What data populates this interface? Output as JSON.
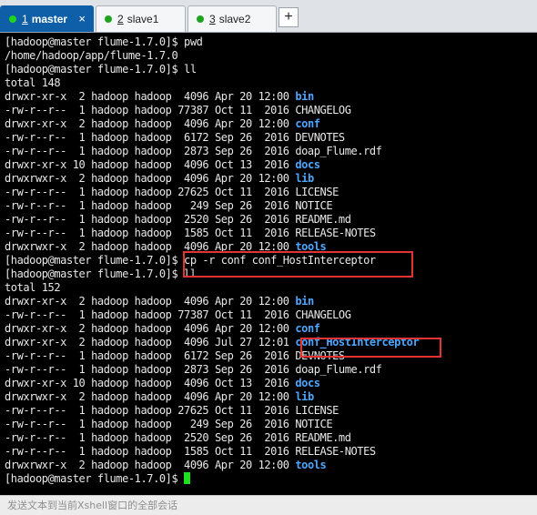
{
  "tabs": [
    {
      "num": "1",
      "label": "master",
      "dot_color": "#1fd41f",
      "active": true
    },
    {
      "num": "2",
      "label": "slave1",
      "dot_color": "#1fa31f",
      "active": false
    },
    {
      "num": "3",
      "label": "slave2",
      "dot_color": "#1fa31f",
      "active": false
    }
  ],
  "add_tab_label": "+",
  "close_glyph": "×",
  "terminal_lines": [
    {
      "segments": [
        {
          "text": "[hadoop@master flume-1.7.0]$ pwd"
        }
      ]
    },
    {
      "segments": [
        {
          "text": "/home/hadoop/app/flume-1.7.0"
        }
      ]
    },
    {
      "segments": [
        {
          "text": "[hadoop@master flume-1.7.0]$ ll"
        }
      ]
    },
    {
      "segments": [
        {
          "text": "total 148"
        }
      ]
    },
    {
      "segments": [
        {
          "text": "drwxr-xr-x  2 hadoop hadoop  4096 Apr 20 12:00 "
        },
        {
          "text": "bin",
          "dir": true
        }
      ]
    },
    {
      "segments": [
        {
          "text": "-rw-r--r--  1 hadoop hadoop 77387 Oct 11  2016 CHANGELOG"
        }
      ]
    },
    {
      "segments": [
        {
          "text": "drwxr-xr-x  2 hadoop hadoop  4096 Apr 20 12:00 "
        },
        {
          "text": "conf",
          "dir": true
        }
      ]
    },
    {
      "segments": [
        {
          "text": "-rw-r--r--  1 hadoop hadoop  6172 Sep 26  2016 DEVNOTES"
        }
      ]
    },
    {
      "segments": [
        {
          "text": "-rw-r--r--  1 hadoop hadoop  2873 Sep 26  2016 doap_Flume.rdf"
        }
      ]
    },
    {
      "segments": [
        {
          "text": "drwxr-xr-x 10 hadoop hadoop  4096 Oct 13  2016 "
        },
        {
          "text": "docs",
          "dir": true
        }
      ]
    },
    {
      "segments": [
        {
          "text": "drwxrwxr-x  2 hadoop hadoop  4096 Apr 20 12:00 "
        },
        {
          "text": "lib",
          "dir": true
        }
      ]
    },
    {
      "segments": [
        {
          "text": "-rw-r--r--  1 hadoop hadoop 27625 Oct 11  2016 LICENSE"
        }
      ]
    },
    {
      "segments": [
        {
          "text": "-rw-r--r--  1 hadoop hadoop   249 Sep 26  2016 NOTICE"
        }
      ]
    },
    {
      "segments": [
        {
          "text": "-rw-r--r--  1 hadoop hadoop  2520 Sep 26  2016 README.md"
        }
      ]
    },
    {
      "segments": [
        {
          "text": "-rw-r--r--  1 hadoop hadoop  1585 Oct 11  2016 RELEASE-NOTES"
        }
      ]
    },
    {
      "segments": [
        {
          "text": "drwxrwxr-x  2 hadoop hadoop  4096 Apr 20 12:00 "
        },
        {
          "text": "tools",
          "dir": true
        }
      ]
    },
    {
      "segments": [
        {
          "text": "[hadoop@master flume-1.7.0]$ cp -r conf conf_HostInterceptor"
        }
      ]
    },
    {
      "segments": [
        {
          "text": "[hadoop@master flume-1.7.0]$ ll"
        }
      ]
    },
    {
      "segments": [
        {
          "text": "total 152"
        }
      ]
    },
    {
      "segments": [
        {
          "text": "drwxr-xr-x  2 hadoop hadoop  4096 Apr 20 12:00 "
        },
        {
          "text": "bin",
          "dir": true
        }
      ]
    },
    {
      "segments": [
        {
          "text": "-rw-r--r--  1 hadoop hadoop 77387 Oct 11  2016 CHANGELOG"
        }
      ]
    },
    {
      "segments": [
        {
          "text": "drwxr-xr-x  2 hadoop hadoop  4096 Apr 20 12:00 "
        },
        {
          "text": "conf",
          "dir": true
        }
      ]
    },
    {
      "segments": [
        {
          "text": "drwxr-xr-x  2 hadoop hadoop  4096 Jul 27 12:01 "
        },
        {
          "text": "conf_HostInterceptor",
          "dir": true
        }
      ]
    },
    {
      "segments": [
        {
          "text": "-rw-r--r--  1 hadoop hadoop  6172 Sep 26  2016 DEVNOTES"
        }
      ]
    },
    {
      "segments": [
        {
          "text": "-rw-r--r--  1 hadoop hadoop  2873 Sep 26  2016 doap_Flume.rdf"
        }
      ]
    },
    {
      "segments": [
        {
          "text": "drwxr-xr-x 10 hadoop hadoop  4096 Oct 13  2016 "
        },
        {
          "text": "docs",
          "dir": true
        }
      ]
    },
    {
      "segments": [
        {
          "text": "drwxrwxr-x  2 hadoop hadoop  4096 Apr 20 12:00 "
        },
        {
          "text": "lib",
          "dir": true
        }
      ]
    },
    {
      "segments": [
        {
          "text": "-rw-r--r--  1 hadoop hadoop 27625 Oct 11  2016 LICENSE"
        }
      ]
    },
    {
      "segments": [
        {
          "text": "-rw-r--r--  1 hadoop hadoop   249 Sep 26  2016 NOTICE"
        }
      ]
    },
    {
      "segments": [
        {
          "text": "-rw-r--r--  1 hadoop hadoop  2520 Sep 26  2016 README.md"
        }
      ]
    },
    {
      "segments": [
        {
          "text": "-rw-r--r--  1 hadoop hadoop  1585 Oct 11  2016 RELEASE-NOTES"
        }
      ]
    },
    {
      "segments": [
        {
          "text": "drwxrwxr-x  2 hadoop hadoop  4096 Apr 20 12:00 "
        },
        {
          "text": "tools",
          "dir": true
        }
      ]
    },
    {
      "segments": [
        {
          "text": "[hadoop@master flume-1.7.0]$ "
        }
      ],
      "cursor": true
    }
  ],
  "colors": {
    "terminal_bg": "#000000",
    "terminal_fg": "#e8e8e8",
    "directory": "#4ea6ff",
    "cursor": "#1ee01e",
    "highlight": "#e23434",
    "active_tab": "#0f5fa8"
  },
  "status_bar": {
    "text": "发送文本到当前Xshell窗口的全部会话"
  }
}
